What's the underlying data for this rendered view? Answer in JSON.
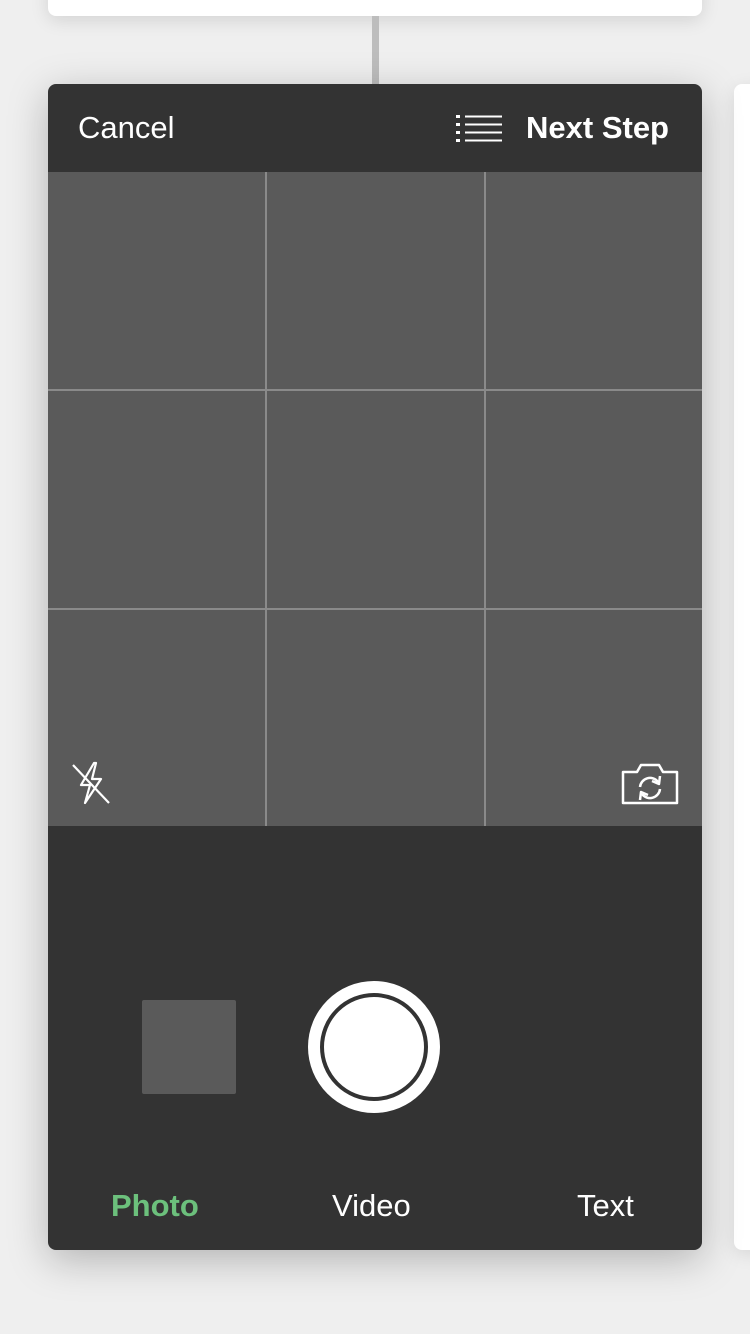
{
  "header": {
    "cancel_label": "Cancel",
    "list_icon": "list-icon",
    "next_label": "Next Step"
  },
  "viewfinder": {
    "grid": "3x3",
    "flash_icon": "flash-off-icon",
    "flip_icon": "camera-flip-icon"
  },
  "modes": {
    "photo": "Photo",
    "video": "Video",
    "text": "Text",
    "active": "Photo"
  },
  "colors": {
    "panel": "#333333",
    "viewfinder": "#5a5a5a",
    "active_mode": "#6cc07c",
    "text": "#ffffff"
  }
}
